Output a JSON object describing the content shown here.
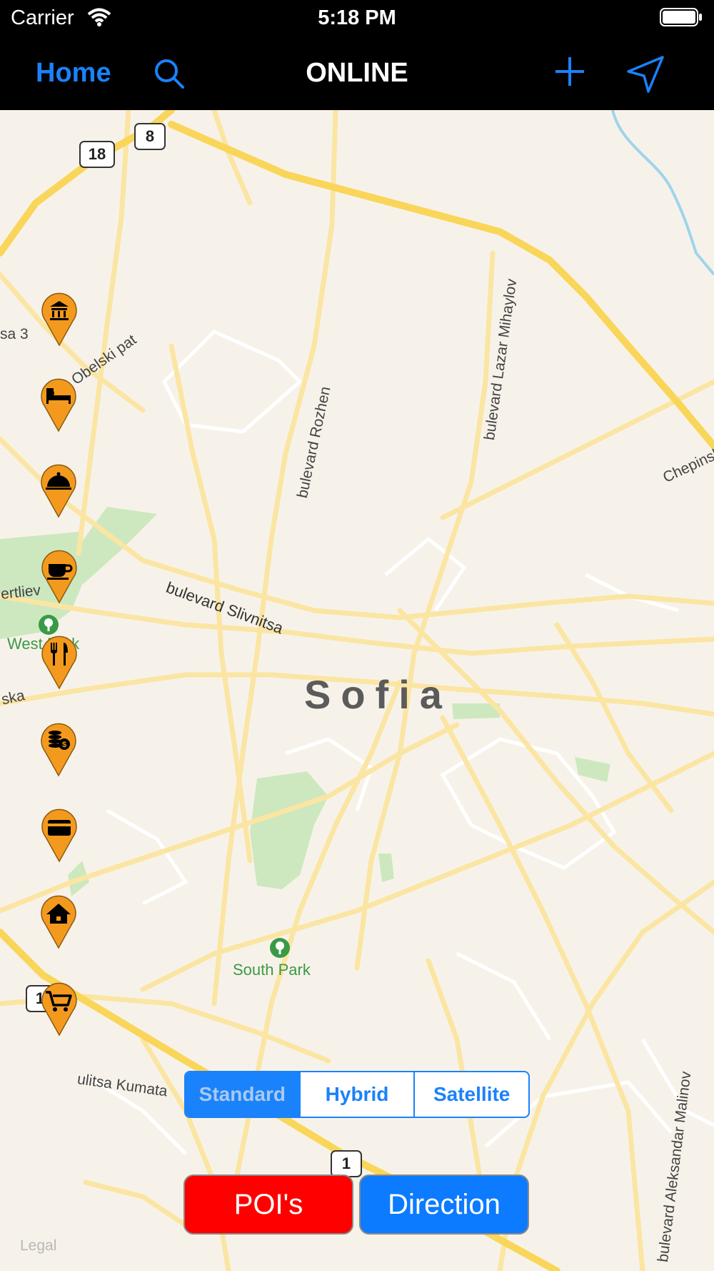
{
  "status_bar": {
    "carrier": "Carrier",
    "time": "5:18 PM"
  },
  "nav": {
    "home": "Home",
    "title": "ONLINE"
  },
  "map": {
    "city": "Sofia",
    "parks": [
      "West Park",
      "South Park"
    ],
    "streets": [
      "bulevard Slivnitsa",
      "bulevard Rozhen",
      "bulevard Lazar Mihaylov",
      "bulevard Aleksandar Malinov",
      "ulitsa Kumata",
      "Chepinsk",
      "Obelski pat",
      "sa 3",
      "ertliev",
      "ska"
    ],
    "road_shields": [
      "18",
      "8",
      "1",
      "1"
    ],
    "poi_icons": [
      "museum-icon",
      "hotel-icon",
      "food-cloche-icon",
      "coffee-icon",
      "restaurant-icon",
      "bank-icon",
      "atm-card-icon",
      "home-icon",
      "shopping-cart-icon"
    ],
    "colors": {
      "pin": "#f39a1e",
      "major_road": "#f9d65a",
      "park": "#cde8bf",
      "water": "#9fd4ec"
    }
  },
  "map_type": {
    "options": [
      "Standard",
      "Hybrid",
      "Satellite"
    ],
    "selected": "Standard"
  },
  "buttons": {
    "pois": "POI's",
    "direction": "Direction"
  },
  "legal": "Legal"
}
